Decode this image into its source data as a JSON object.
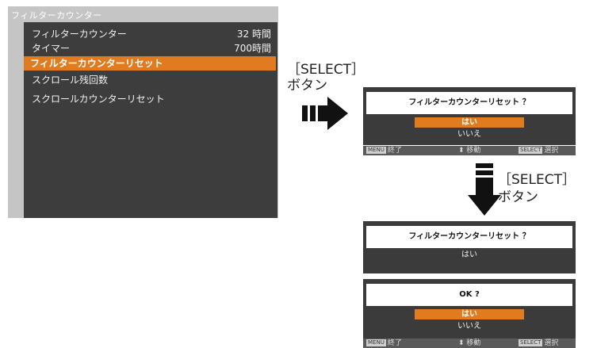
{
  "menu": {
    "title": "フィルターカウンター",
    "items": [
      {
        "label": "フィルターカウンター",
        "value": "32 時間"
      },
      {
        "label": "タイマー",
        "value": "700時間"
      },
      {
        "label": "フィルターカウンターリセット",
        "value": ""
      },
      {
        "label": "スクロール残回数",
        "value": ""
      },
      {
        "label": "スクロールカウンターリセット",
        "value": ""
      }
    ],
    "selected_index": 2
  },
  "captions": {
    "select_key_1": "［SELECT］",
    "button_1": "ボタン",
    "select_key_2": "［SELECT］",
    "button_2": "ボタン"
  },
  "dialog_confirm": {
    "question": "フィルターカウンターリセット ？",
    "yes": "はい",
    "no": "いいえ"
  },
  "dialog_result": {
    "question": "フィルターカウンターリセット ？",
    "answer": "はい"
  },
  "dialog_ok": {
    "question": "OK ?",
    "yes": "はい",
    "no": "いいえ"
  },
  "statusbar": {
    "menu_key": "MENU",
    "exit": "終了",
    "move": "移動",
    "select_key": "SELECT",
    "select": "選択"
  },
  "colors": {
    "highlight": "#e07b20",
    "osd_background": "#3d3d3d",
    "osd_frame": "#c5c5c5"
  }
}
